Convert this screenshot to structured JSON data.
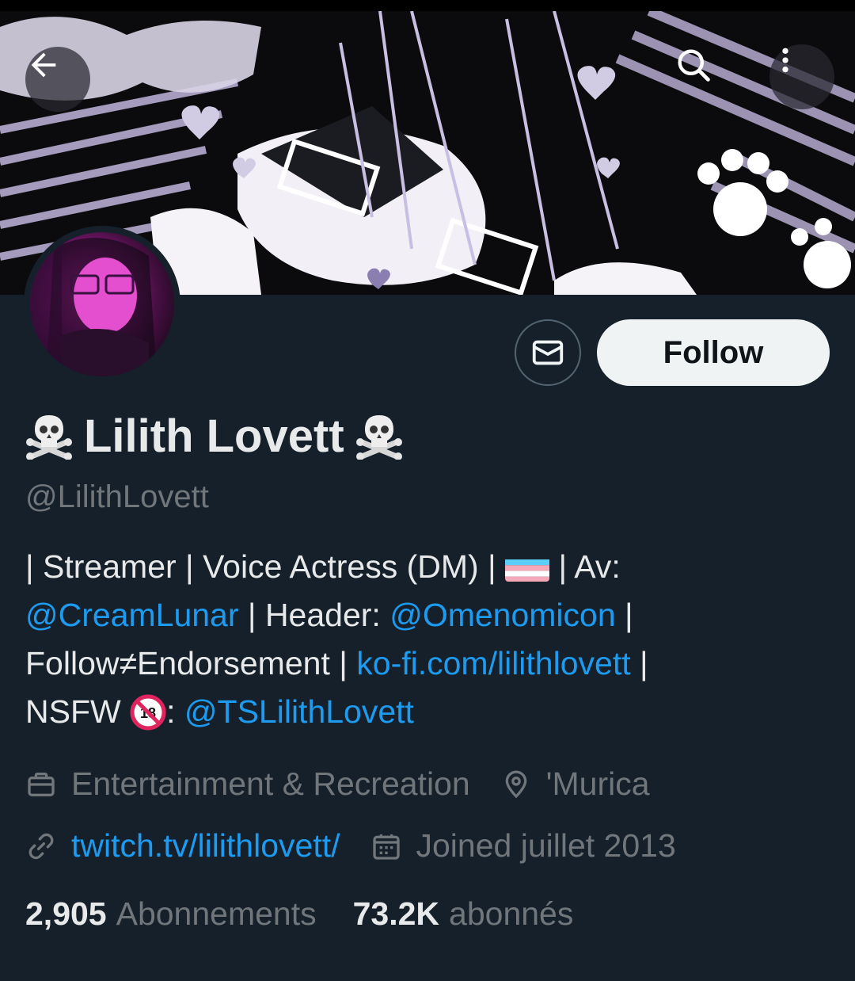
{
  "profile": {
    "name": "Lilith Lovett",
    "handle": "@LilithLovett",
    "follow_label": "Follow"
  },
  "bio": {
    "line1_a": "| Streamer | Voice Actress (DM) |",
    "line1_b": "| Av:",
    "link_creamlunar": "@CreamLunar",
    "line2_a": " | Header: ",
    "link_omenomicon": "@Omenomicon",
    "line2_b": " |",
    "line3_a": "Follow≠Endorsement | ",
    "link_kofi": "ko-fi.com/lilithlovett",
    "line3_b": " |",
    "line4_a": "NSFW",
    "line4_b": ": ",
    "link_nsfw": "@TSLilithLovett"
  },
  "meta": {
    "category": "Entertainment & Recreation",
    "location": "'Murica",
    "website": "twitch.tv/lilithlovett/",
    "joined": "Joined juillet 2013"
  },
  "stats": {
    "following_count": "2,905",
    "following_label": "Abonnements",
    "followers_count": "73.2K",
    "followers_label": "abonnés"
  },
  "icons": {
    "back": "arrow-left-icon",
    "search": "search-icon",
    "more": "more-vertical-icon",
    "message": "envelope-icon",
    "category": "briefcase-icon",
    "location": "location-pin-icon",
    "website": "link-icon",
    "joined": "calendar-icon"
  },
  "colors": {
    "background": "#15202b",
    "link": "#1d9bf0",
    "muted": "#71767b",
    "follow_bg": "#eff3f4"
  }
}
